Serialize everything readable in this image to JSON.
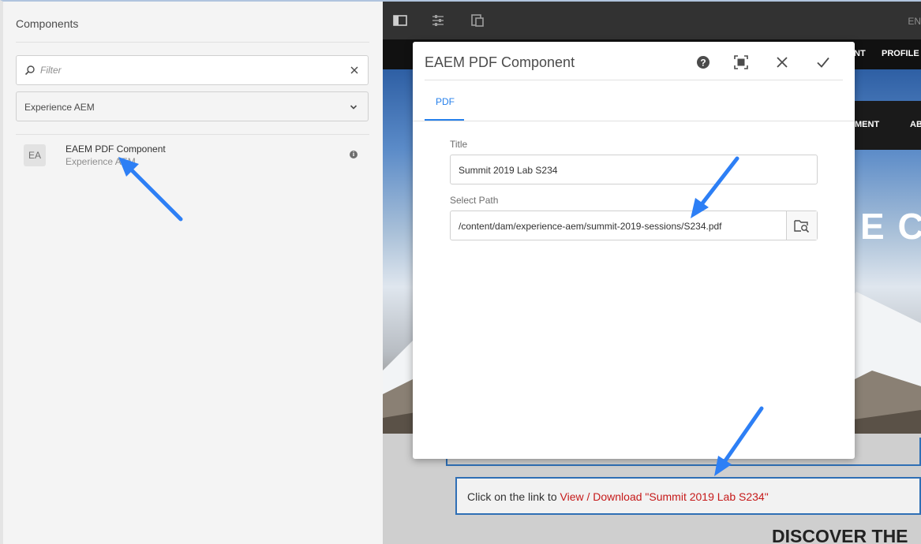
{
  "sidebar": {
    "title": "Components",
    "filter": {
      "placeholder": "Filter",
      "value": ""
    },
    "group_select": {
      "value": "Experience AEM"
    },
    "components": [
      {
        "abbr": "EA",
        "name": "EAEM PDF Component",
        "group": "Experience AEM"
      }
    ]
  },
  "toolbar": {
    "icons": [
      "side-panel-icon",
      "properties-icon",
      "emulator-icon"
    ],
    "language": "EN"
  },
  "preview": {
    "nav_text_1": "NT",
    "nav_text_2": "PROFILE",
    "menu_text_1": "MENT",
    "menu_text_2": "AB",
    "hero_text": "E CO",
    "pdf_link_prefix": "Click on the link to ",
    "pdf_link_text": "View / Download \"Summit 2019 Lab S234\"",
    "discover_text": "DISCOVER THE"
  },
  "dialog": {
    "title": "EAEM PDF Component",
    "tabs": [
      {
        "label": "PDF"
      }
    ],
    "fields": {
      "title_label": "Title",
      "title_value": "Summit 2019 Lab S234",
      "path_label": "Select Path",
      "path_value": "/content/dam/experience-aem/summit-2019-sessions/S234.pdf"
    }
  },
  "colors": {
    "accent": "#2680eb",
    "arrow": "#2d7ff5",
    "link": "#c61a1a",
    "toolbar_bg": "#323232"
  }
}
